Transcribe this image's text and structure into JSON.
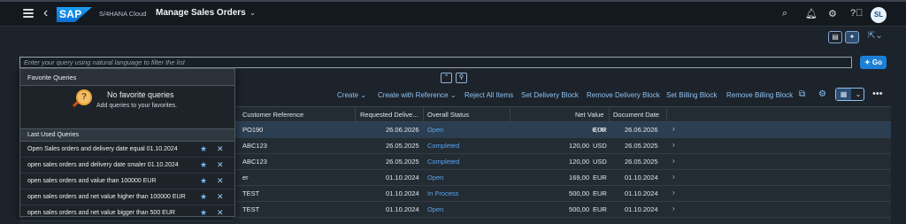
{
  "shell": {
    "logo": "SAP",
    "product": "S/4HANA Cloud",
    "app_title": "Manage Sales Orders",
    "avatar": "SL",
    "icons": [
      "search-icon",
      "bell-icon",
      "support-icon",
      "help-icon"
    ]
  },
  "query": {
    "placeholder": "Enter your query using natural language to filter the list",
    "go_label": "Go"
  },
  "toolbar": {
    "create": "Create",
    "create_with_reference": "Create with Reference",
    "reject_all_items": "Reject All Items",
    "set_delivery_block": "Set Delivery Block",
    "remove_delivery_block": "Remove Delivery Block",
    "set_billing_block": "Set Billing Block",
    "remove_billing_block": "Remove Billing Block"
  },
  "table": {
    "columns": [
      "Customer Reference",
      "Requested Delive...",
      "Overall Status",
      "Net Value",
      "Document Date"
    ],
    "rows": [
      {
        "ref": "PO190",
        "req_date": "26.06.2026",
        "status": "Open",
        "net": "0,00",
        "cur": "EUR",
        "doc_date": "26.06.2026"
      },
      {
        "ref": "ABC123",
        "req_date": "26.05.2025",
        "status": "Completed",
        "net": "120,00",
        "cur": "USD",
        "doc_date": "26.05.2025"
      },
      {
        "ref": "ABC123",
        "req_date": "26.05.2025",
        "status": "Completed",
        "net": "120,00",
        "cur": "USD",
        "doc_date": "26.05.2025"
      },
      {
        "ref": "er",
        "req_date": "01.10.2024",
        "status": "Open",
        "net": "169,00",
        "cur": "EUR",
        "doc_date": "01.10.2024"
      },
      {
        "ref": "TEST",
        "req_date": "01.10.2024",
        "status": "In Process",
        "net": "500,00",
        "cur": "EUR",
        "doc_date": "01.10.2024"
      },
      {
        "ref": "TEST",
        "req_date": "01.10.2024",
        "status": "Open",
        "net": "500,00",
        "cur": "EUR",
        "doc_date": "01.10.2024"
      }
    ]
  },
  "popover": {
    "favorite_header": "Favorite Queries",
    "no_favorites_title": "No favorite queries",
    "no_favorites_sub": "Add queries to your favorites.",
    "last_used_header": "Last Used Queries",
    "last_used": [
      "Open Sales orders and delivery date equal 01.10.2024",
      "open sales orders and delivery date smaler 01.10.2024",
      "open sales orders and value than 100000 EUR",
      "open sales orders and net value higher than 100000 EUR",
      "open sales orders and net value bigger than 500 EUR"
    ]
  },
  "colors": {
    "accent": "#1b7fd6",
    "status_link": "#5aa6f0",
    "background": "#1d232a"
  }
}
